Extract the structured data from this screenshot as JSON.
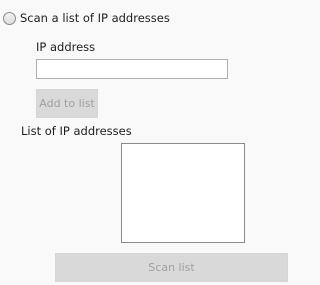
{
  "scan_option": {
    "label": "Scan a list of IP addresses",
    "selected": false
  },
  "ip_address": {
    "label": "IP address",
    "value": "",
    "placeholder": ""
  },
  "add_button": {
    "label": "Add to list",
    "enabled": false
  },
  "ip_list": {
    "label": "List of IP addresses",
    "items": []
  },
  "scan_button": {
    "label": "Scan list",
    "enabled": false
  }
}
